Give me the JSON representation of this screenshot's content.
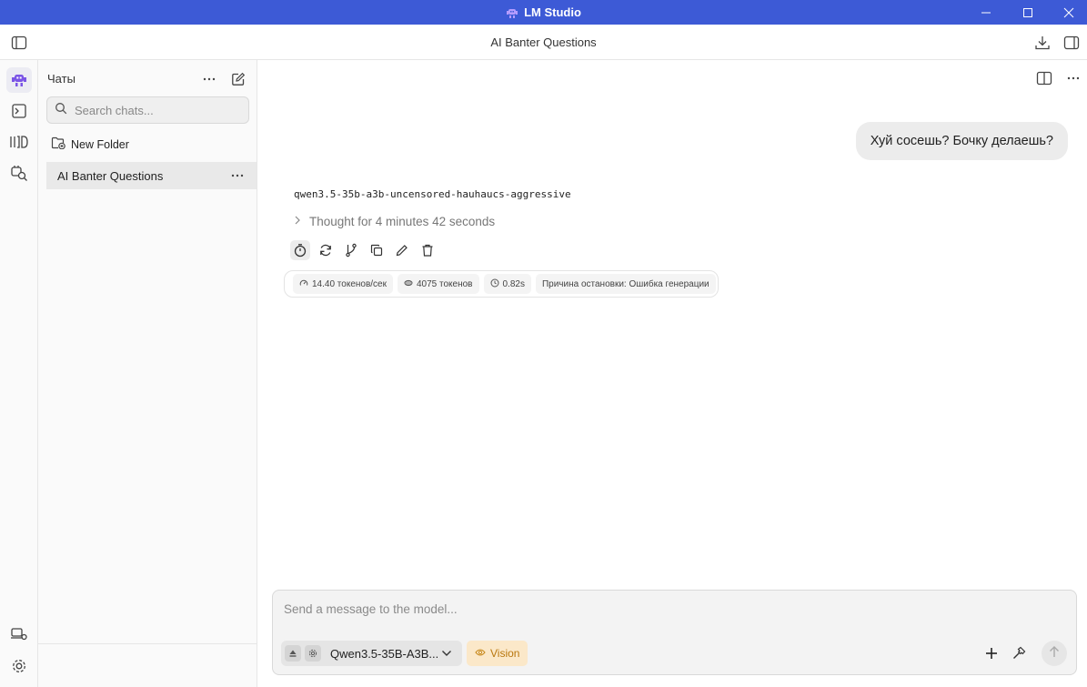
{
  "window": {
    "title": "LM Studio"
  },
  "topbar": {
    "chat_title": "AI Banter Questions"
  },
  "sidebar": {
    "heading": "Чаты",
    "search_placeholder": "Search chats...",
    "new_folder_label": "New Folder",
    "chats": [
      {
        "label": "AI Banter Questions",
        "selected": true
      }
    ]
  },
  "conversation": {
    "user_message": "Хуй сосешь? Бочку делаешь?",
    "assistant": {
      "model_name": "qwen3.5-35b-a3b-uncensored-hauhaucs-aggressive",
      "thought_label": "Thought for 4 minutes 42 seconds",
      "stats": {
        "speed": "14.40 токенов/сек",
        "tokens": "4075 токенов",
        "time": "0.82s",
        "stop_reason": "Причина остановки: Ошибка генерации"
      }
    }
  },
  "composer": {
    "placeholder": "Send a message to the model...",
    "model_label": "Qwen3.5-35B-A3B...",
    "vision_label": "Vision"
  },
  "colors": {
    "titlebar": "#3d5ad6",
    "accent_purple": "#7b55e6",
    "vision_bg": "#fbe8c9",
    "vision_text": "#b9770e"
  },
  "icons": {
    "rail": [
      "chat-icon",
      "terminal-icon",
      "models-icon",
      "search-models-icon",
      "devices-icon",
      "settings-icon"
    ],
    "message_actions": [
      "timer-icon",
      "regenerate-icon",
      "branch-icon",
      "copy-icon",
      "edit-icon",
      "delete-icon"
    ]
  }
}
